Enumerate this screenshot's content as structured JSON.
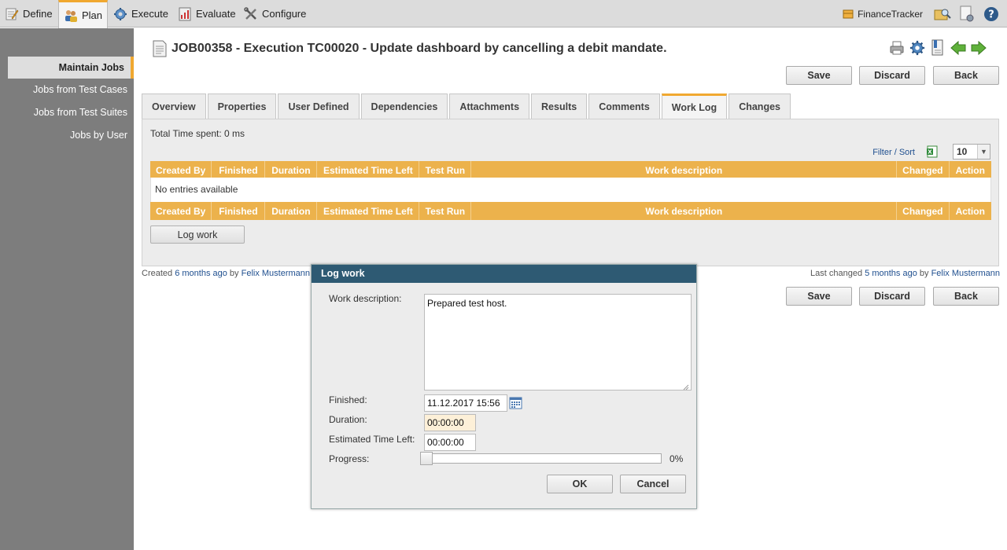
{
  "nav": {
    "items": [
      {
        "label": "Define",
        "icon": "pencil-notepad-icon"
      },
      {
        "label": "Plan",
        "icon": "users-plan-icon"
      },
      {
        "label": "Execute",
        "icon": "gear-icon"
      },
      {
        "label": "Evaluate",
        "icon": "report-icon"
      },
      {
        "label": "Configure",
        "icon": "tools-icon"
      }
    ],
    "active": "Plan",
    "project": "FinanceTracker"
  },
  "sidebar": {
    "items": [
      {
        "label": "Maintain Jobs"
      },
      {
        "label": "Jobs from Test Cases"
      },
      {
        "label": "Jobs from Test Suites"
      },
      {
        "label": "Jobs by User"
      }
    ]
  },
  "page": {
    "title": "JOB00358 - Execution TC00020 - Update dashboard by cancelling a debit mandate.",
    "save_label": "Save",
    "discard_label": "Discard",
    "back_label": "Back"
  },
  "tabs": [
    {
      "label": "Overview"
    },
    {
      "label": "Properties"
    },
    {
      "label": "User Defined"
    },
    {
      "label": "Dependencies"
    },
    {
      "label": "Attachments"
    },
    {
      "label": "Results"
    },
    {
      "label": "Comments"
    },
    {
      "label": "Work Log"
    },
    {
      "label": "Changes"
    }
  ],
  "worklog": {
    "total_time": "Total Time spent: 0 ms",
    "filter_sort": "Filter / Sort",
    "page_size": "10",
    "columns": [
      "Created By",
      "Finished",
      "Duration",
      "Estimated Time Left",
      "Test Run",
      "Work description",
      "Changed",
      "Action"
    ],
    "empty_text": "No entries available",
    "log_work_button": "Log work"
  },
  "meta": {
    "created_prefix": "Created",
    "created_when": "6 months ago",
    "by": "by",
    "created_by": "Felix Mustermann",
    "changed_prefix": "Last changed",
    "changed_when": "5 months ago",
    "changed_by": "Felix Mustermann"
  },
  "dialog": {
    "title": "Log work",
    "work_description_label": "Work description:",
    "work_description_value": "Prepared test host.",
    "finished_label": "Finished:",
    "finished_value": "11.12.2017 15:56",
    "duration_label": "Duration:",
    "duration_value": "00:00:00",
    "etl_label": "Estimated Time Left:",
    "etl_value": "00:00:00",
    "progress_label": "Progress:",
    "progress_value": "0%",
    "progress_fraction": 0,
    "ok_label": "OK",
    "cancel_label": "Cancel"
  },
  "colors": {
    "accent": "#f0a830",
    "table_header": "#ecb24c",
    "dialog_title": "#2e5a73",
    "link": "#1f4f8f",
    "sidebar_bg": "#7d7d7d"
  }
}
